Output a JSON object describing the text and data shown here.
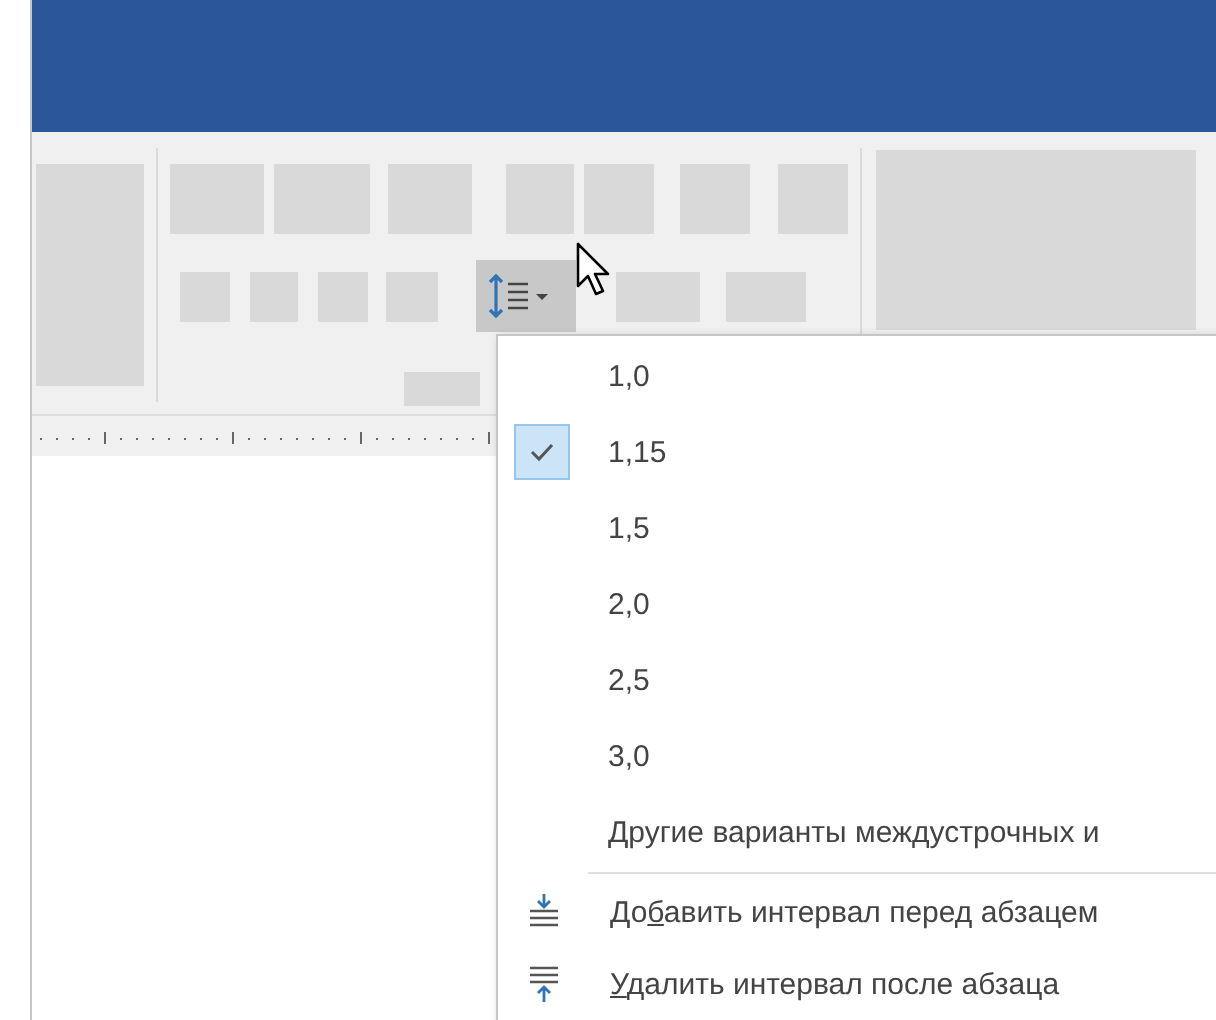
{
  "line_spacing_button": {
    "expanded": true
  },
  "menu": {
    "items": [
      {
        "kind": "value",
        "label": "1,0",
        "checked": false
      },
      {
        "kind": "value",
        "label": "1,15",
        "checked": true
      },
      {
        "kind": "value",
        "label": "1,5",
        "checked": false
      },
      {
        "kind": "value",
        "label": "2,0",
        "checked": false
      },
      {
        "kind": "value",
        "label": "2,5",
        "checked": false
      },
      {
        "kind": "value",
        "label": "3,0",
        "checked": false
      },
      {
        "kind": "more",
        "label": "Другие варианты междустрочных и"
      },
      {
        "kind": "add-before",
        "label_before": "До",
        "access_key": "б",
        "label_after": "авить интервал перед абзацем"
      },
      {
        "kind": "remove-after",
        "access_key": "У",
        "label_after": "далить интервал после абзаца"
      }
    ]
  }
}
